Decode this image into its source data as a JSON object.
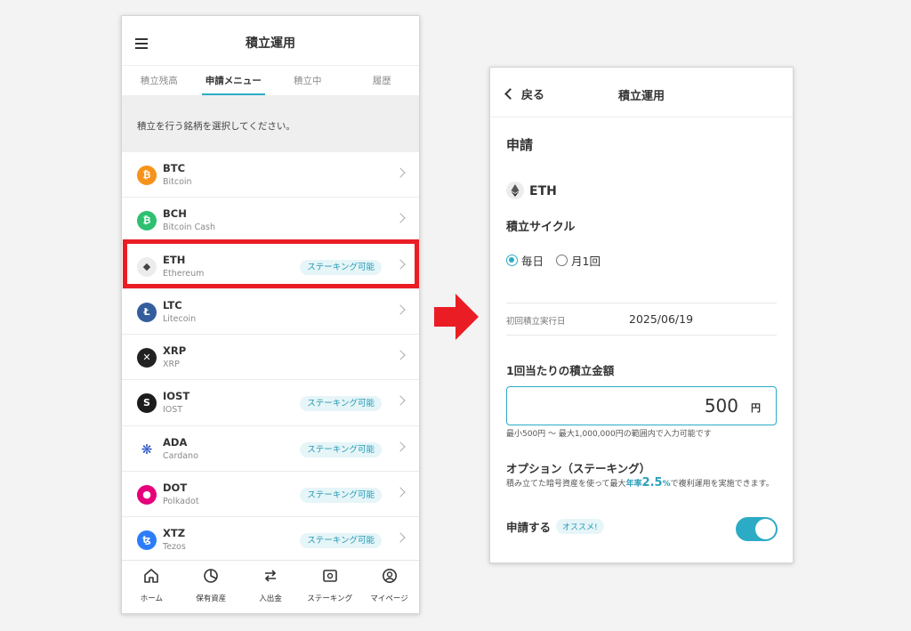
{
  "left": {
    "header_title": "積立運用",
    "tabs": [
      {
        "label": "積立残高"
      },
      {
        "label": "申請メニュー"
      },
      {
        "label": "積立中"
      },
      {
        "label": "履歴"
      }
    ],
    "notice": "積立を行う銘柄を選択してください。",
    "coins": [
      {
        "symbol": "BTC",
        "name": "Bitcoin",
        "badge": "",
        "color": "#f7931a",
        "glyph": "₿"
      },
      {
        "symbol": "BCH",
        "name": "Bitcoin Cash",
        "badge": "",
        "color": "#2fbf71",
        "glyph": "₿"
      },
      {
        "symbol": "ETH",
        "name": "Ethereum",
        "badge": "ステーキング可能",
        "color": "#ececec",
        "glyph": "◆"
      },
      {
        "symbol": "LTC",
        "name": "Litecoin",
        "badge": "",
        "color": "#345d9d",
        "glyph": "Ł"
      },
      {
        "symbol": "XRP",
        "name": "XRP",
        "badge": "",
        "color": "#222222",
        "glyph": "✕"
      },
      {
        "symbol": "IOST",
        "name": "IOST",
        "badge": "ステーキング可能",
        "color": "#1c1c1c",
        "glyph": "S"
      },
      {
        "symbol": "ADA",
        "name": "Cardano",
        "badge": "ステーキング可能",
        "color": "#ffffff",
        "glyph": "❋"
      },
      {
        "symbol": "DOT",
        "name": "Polkadot",
        "badge": "ステーキング可能",
        "color": "#e6007a",
        "glyph": "●"
      },
      {
        "symbol": "XTZ",
        "name": "Tezos",
        "badge": "ステーキング可能",
        "color": "#2c7df7",
        "glyph": "ꜩ"
      }
    ],
    "nav": [
      {
        "label": "ホーム",
        "icon": "home-icon"
      },
      {
        "label": "保有資産",
        "icon": "pie-chart-icon"
      },
      {
        "label": "入出金",
        "icon": "transfer-icon"
      },
      {
        "label": "ステーキング",
        "icon": "safe-icon"
      },
      {
        "label": "マイページ",
        "icon": "user-icon"
      }
    ]
  },
  "right": {
    "back_label": "戻る",
    "header_title": "積立運用",
    "section_title": "申請",
    "asset": "ETH",
    "cycle_label": "積立サイクル",
    "cycle_options": [
      {
        "label": "毎日",
        "selected": true
      },
      {
        "label": "月1回",
        "selected": false
      }
    ],
    "first_date_label": "初回積立実行日",
    "first_date": "2025/06/19",
    "amount_label": "1回当たりの積立金額",
    "amount_value": "500",
    "amount_unit": "円",
    "amount_note": "最小500円 ～ 最大1,000,000円の範囲内で入力可能です",
    "option_title": "オプション（ステーキング）",
    "option_desc_pre": "積み立てた暗号資産を使って最大",
    "option_desc_rate_label": "年率",
    "option_desc_rate": "2.5",
    "option_desc_pct": "%",
    "option_desc_post": "で複利運用を実施できます。",
    "apply_label": "申請する",
    "recommend_badge": "オススメ!",
    "apply_toggle_on": true
  },
  "colors": {
    "accent": "#2cabc6",
    "highlight_border": "#ea1d25",
    "arrow": "#ea1d25"
  }
}
